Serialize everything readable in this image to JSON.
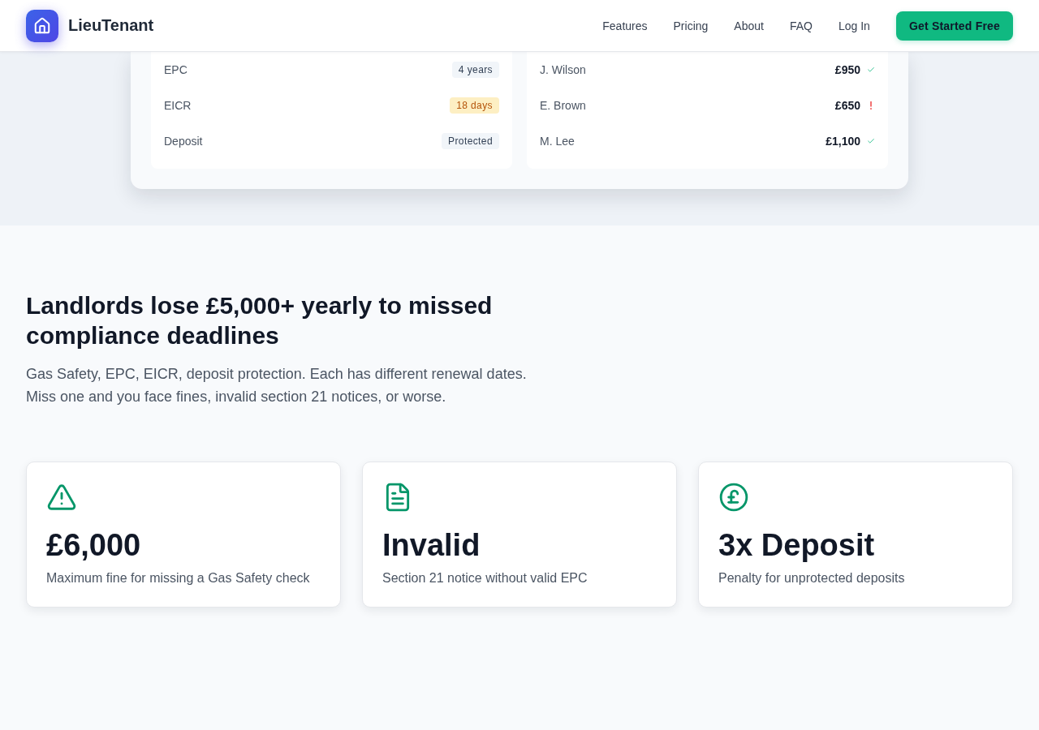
{
  "header": {
    "brand": "LieuTenant",
    "nav": [
      "Features",
      "Pricing",
      "About",
      "FAQ",
      "Log In"
    ],
    "cta": "Get Started Free"
  },
  "dashboard": {
    "compliance": [
      {
        "label": "EPC",
        "badge": "4 years",
        "kind": "neutral"
      },
      {
        "label": "EICR",
        "badge": "18 days",
        "kind": "warning"
      },
      {
        "label": "Deposit",
        "badge": "Protected",
        "kind": "neutral"
      }
    ],
    "rent": [
      {
        "tenant": "J. Wilson",
        "amount": "£950",
        "kind": "paid"
      },
      {
        "tenant": "E. Brown",
        "amount": "£650",
        "kind": "overdue"
      },
      {
        "tenant": "M. Lee",
        "amount": "£1,100",
        "kind": "paid"
      }
    ]
  },
  "problem": {
    "heading": "Landlords lose £5,000+ yearly to missed compliance deadlines",
    "body": "Gas Safety, EPC, EICR, deposit protection. Each has different renewal dates. Miss one and you face fines, invalid section 21 notices, or worse.",
    "stats": [
      {
        "kind": "alert",
        "value": "£6,000",
        "caption": "Maximum fine for missing a Gas Safety check"
      },
      {
        "kind": "document",
        "value": "Invalid",
        "caption": "Section 21 notice without valid EPC"
      },
      {
        "kind": "pound",
        "value": "3x Deposit",
        "caption": "Penalty for unprotected deposits"
      }
    ]
  }
}
